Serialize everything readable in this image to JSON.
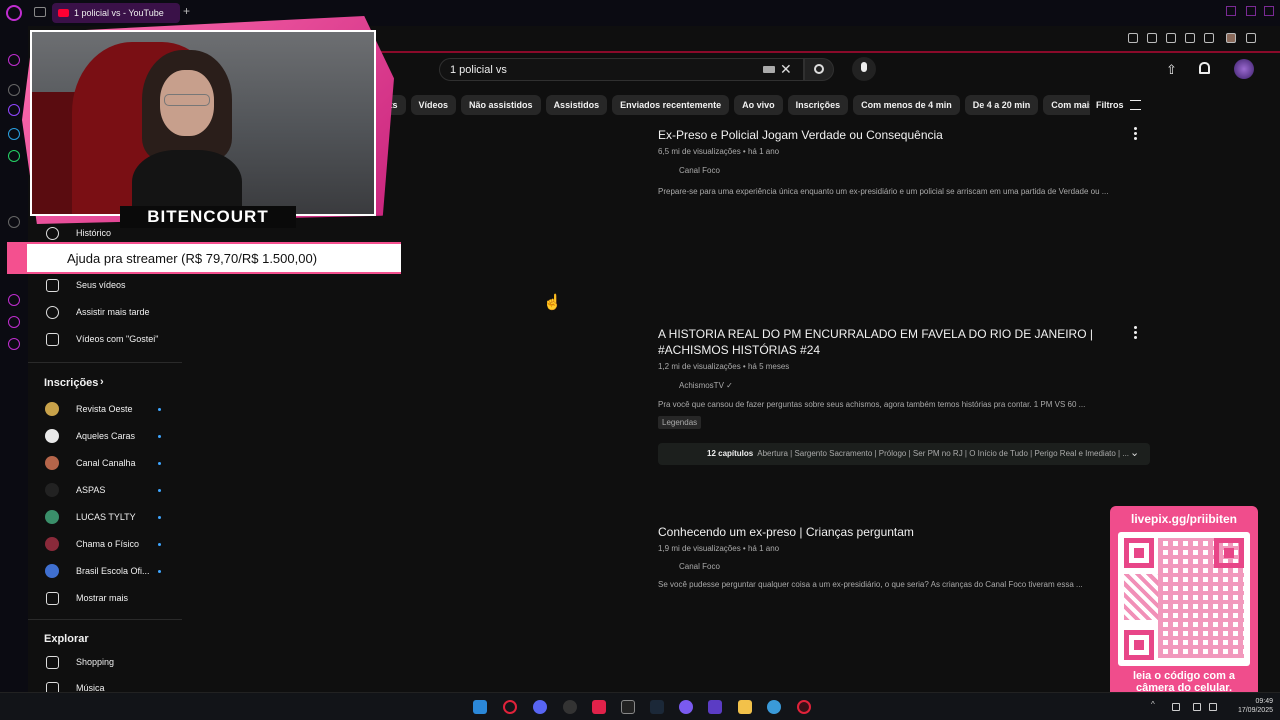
{
  "browser": {
    "tab_title": "1 policial vs - YouTube"
  },
  "youtube": {
    "search_value": "1 policial vs",
    "chips": [
      "rts",
      "Vídeos",
      "Não assistidos",
      "Assistidos",
      "Enviados recentemente",
      "Ao vivo",
      "Inscrições",
      "Com menos de 4 min",
      "De 4 a 20 min",
      "Com mais"
    ],
    "filters_label": "Filtros"
  },
  "sidebar": {
    "you_items": [
      {
        "label": "Histórico",
        "icon": "history-icon"
      },
      {
        "label": "Seus vídeos",
        "icon": "your-videos-icon"
      },
      {
        "label": "Assistir mais tarde",
        "icon": "watch-later-icon"
      },
      {
        "label": "Vídeos com \"Gostei\"",
        "icon": "thumbs-up-icon"
      }
    ],
    "subscriptions_title": "Inscrições",
    "subscriptions": [
      {
        "label": "Revista Oeste",
        "color": "#c8a24a"
      },
      {
        "label": "Aqueles Caras",
        "color": "#e9e9e9"
      },
      {
        "label": "Canal Canalha",
        "color": "#b5654a"
      },
      {
        "label": "ASPAS",
        "color": "#222222"
      },
      {
        "label": "LUCAS TYLTY",
        "color": "#3a8f6a"
      },
      {
        "label": "Chama o Físico",
        "color": "#8a2a3a"
      },
      {
        "label": "Brasil Escola Ofi...",
        "color": "#3f6fd0"
      }
    ],
    "show_more": "Mostrar mais",
    "explore_title": "Explorar",
    "explore_items": [
      {
        "label": "Shopping",
        "icon": "shopping-bag-icon"
      },
      {
        "label": "Música",
        "icon": "music-icon"
      }
    ]
  },
  "videos": [
    {
      "title": "Ex-Preso e Policial Jogam Verdade ou Consequência",
      "meta": "6,5 mi de visualizações • há 1 ano",
      "channel": "Canal Foco",
      "description": "Prepare-se para uma experiência única enquanto um ex-presidiário e um policial se arriscam em uma partida de Verdade ou ..."
    },
    {
      "title": "A HISTORIA REAL DO PM ENCURRALADO EM FAVELA DO RIO DE JANEIRO | #ACHISMOS HISTÓRIAS #24",
      "meta": "1,2 mi de visualizações • há 5 meses",
      "channel": "AchismosTV",
      "verified": "✓",
      "description": "Pra você que cansou de fazer perguntas sobre seus achismos, agora também temos histórias pra contar. 1 PM VS 60 ...",
      "badge": "Legendas",
      "chapters_count": "12 capítulos",
      "chapters_text": "Abertura | Sargento Sacramento | Prólogo | Ser PM no RJ | O Início de Tudo | Perigo Real e Imediato | ..."
    },
    {
      "title": "Conhecendo um ex-preso | Crianças perguntam",
      "meta": "1,9 mi de visualizações • há 1 ano",
      "channel": "Canal Foco",
      "description": "Se você pudesse perguntar qualquer coisa a um ex-presidiário, o que seria? As crianças do Canal Foco tiveram essa ..."
    }
  ],
  "overlay": {
    "streamer_name": "BITENCOURT",
    "donation_text": "Ajuda pra streamer (R$ 79,70/R$ 1.500,00)",
    "qr_url": "livepix.gg/priibiten",
    "qr_caption_line1": "leia o código com a",
    "qr_caption_line2": "câmera do celular."
  },
  "taskbar": {
    "time": "09:49",
    "date": "17/09/2025"
  },
  "colors": {
    "accent": "#f04d8c",
    "youtube_red": "#ff0033",
    "opera": "#c02dd0"
  }
}
